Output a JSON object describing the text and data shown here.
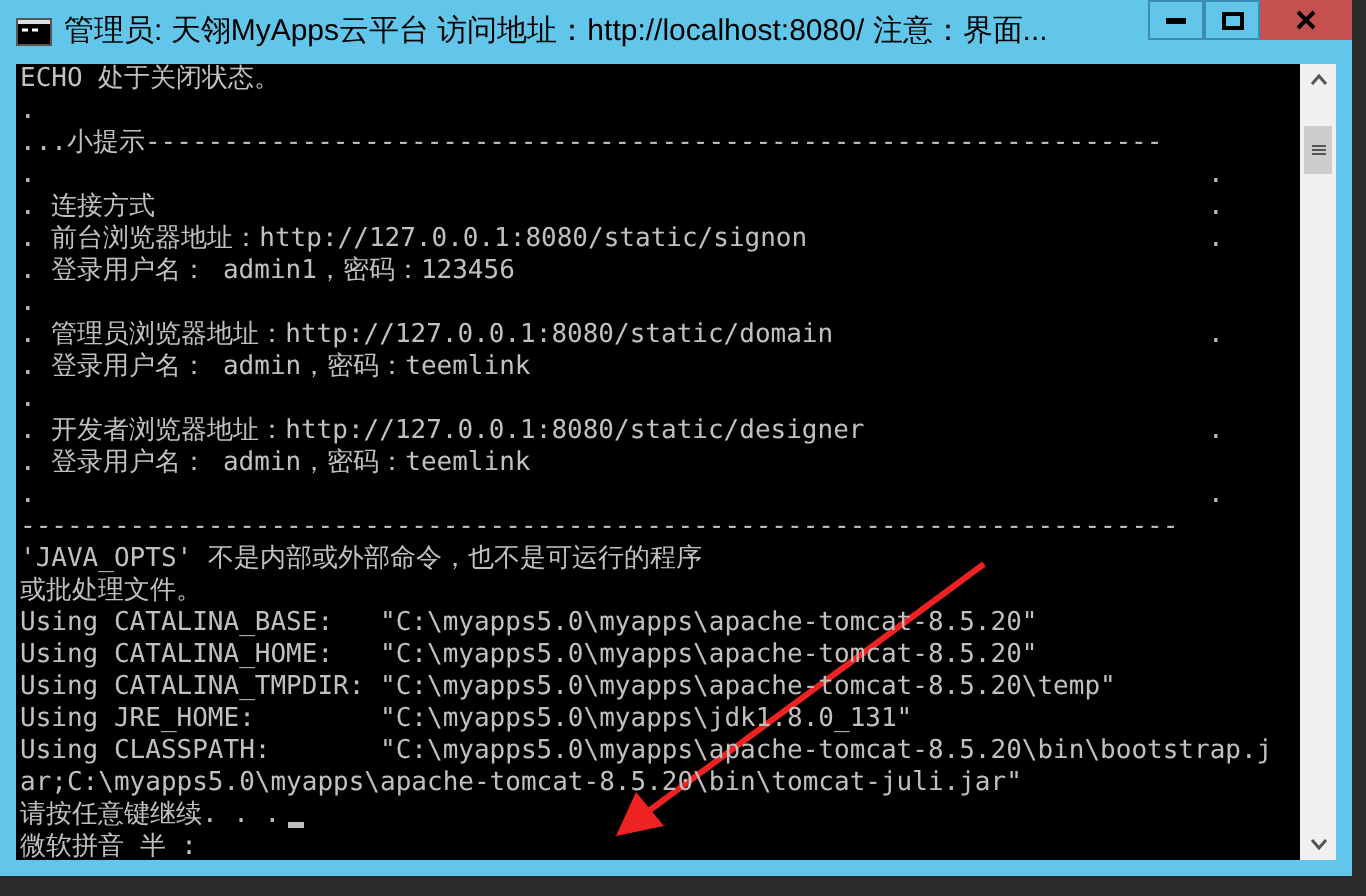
{
  "window": {
    "title": "管理员: 天翎MyApps云平台 访问地址：http://localhost:8080/ 注意：界面..."
  },
  "console_lines": [
    {
      "text": "ECHO 处于关闭状态。"
    },
    {
      "text": "."
    },
    {
      "text": "...小提示-----------------------------------------------------------------"
    },
    {
      "text": ".",
      "end": "."
    },
    {
      "text": ". 连接方式",
      "end": "."
    },
    {
      "text": ". 前台浏览器地址：http://127.0.0.1:8080/static/signon",
      "end": "."
    },
    {
      "text": ". 登录用户名： admin1，密码：123456"
    },
    {
      "text": "."
    },
    {
      "text": ". 管理员浏览器地址：http://127.0.0.1:8080/static/domain",
      "end": "."
    },
    {
      "text": ". 登录用户名： admin，密码：teemlink"
    },
    {
      "text": "."
    },
    {
      "text": ". 开发者浏览器地址：http://127.0.0.1:8080/static/designer",
      "end": "."
    },
    {
      "text": ". 登录用户名： admin，密码：teemlink"
    },
    {
      "text": ".",
      "end": "."
    },
    {
      "text": "--------------------------------------------------------------------------"
    },
    {
      "text": "'JAVA_OPTS' 不是内部或外部命令，也不是可运行的程序"
    },
    {
      "text": "或批处理文件。"
    },
    {
      "text": "Using CATALINA_BASE:   \"C:\\myapps5.0\\myapps\\apache-tomcat-8.5.20\""
    },
    {
      "text": "Using CATALINA_HOME:   \"C:\\myapps5.0\\myapps\\apache-tomcat-8.5.20\""
    },
    {
      "text": "Using CATALINA_TMPDIR: \"C:\\myapps5.0\\myapps\\apache-tomcat-8.5.20\\temp\""
    },
    {
      "text": "Using JRE_HOME:        \"C:\\myapps5.0\\myapps\\jdk1.8.0_131\""
    },
    {
      "text": "Using CLASSPATH:       \"C:\\myapps5.0\\myapps\\apache-tomcat-8.5.20\\bin\\bootstrap.j"
    },
    {
      "text": "ar;C:\\myapps5.0\\myapps\\apache-tomcat-8.5.20\\bin\\tomcat-juli.jar\""
    },
    {
      "text": "请按任意键继续. . .",
      "cursor": true
    },
    {
      "text": "微软拼音 半 :"
    }
  ]
}
